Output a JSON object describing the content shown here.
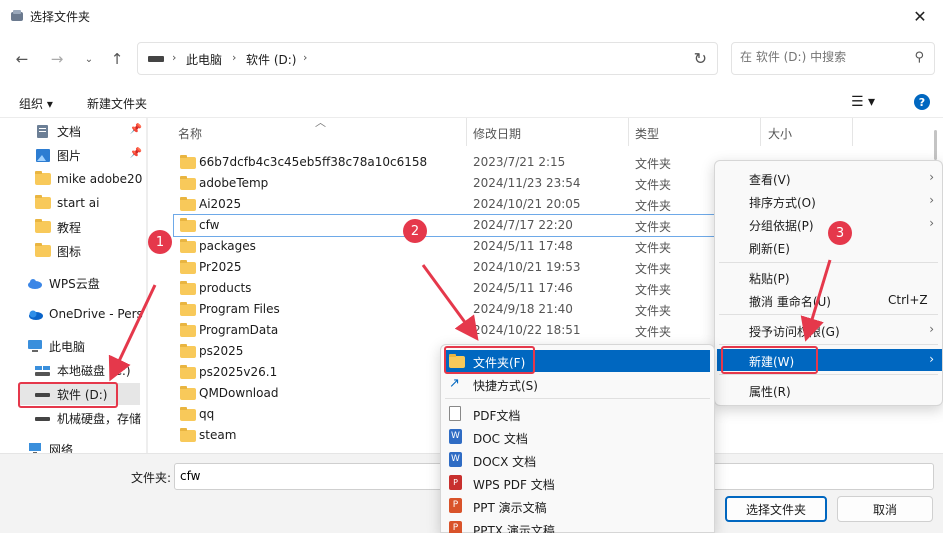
{
  "window": {
    "title": "选择文件夹",
    "close_glyph": "✕"
  },
  "address": {
    "segments": [
      "此电脑",
      "软件 (D:)"
    ]
  },
  "search": {
    "placeholder": "在 软件 (D:) 中搜索"
  },
  "toolbar": {
    "organize": "组织 ▾",
    "new_folder": "新建文件夹"
  },
  "sidebar": {
    "items": [
      {
        "label": "文档",
        "icon": "documents-icon",
        "pinned": true
      },
      {
        "label": "图片",
        "icon": "pictures-icon",
        "pinned": true
      },
      {
        "label": "mike adobe20",
        "icon": "folder-icon"
      },
      {
        "label": "start ai",
        "icon": "folder-icon"
      },
      {
        "label": "教程",
        "icon": "folder-icon"
      },
      {
        "label": "图标",
        "icon": "folder-icon"
      },
      {
        "label": "WPS云盘",
        "icon": "cloud-icon"
      },
      {
        "label": "OneDrive - Pers",
        "icon": "onedrive-icon"
      },
      {
        "label": "此电脑",
        "icon": "computer-icon"
      },
      {
        "label": "本地磁盘 (C:)",
        "icon": "drive-icon"
      },
      {
        "label": "软件 (D:)",
        "icon": "drive-icon",
        "selected": true
      },
      {
        "label": "机械硬盘，存储",
        "icon": "drive-icon"
      },
      {
        "label": "网络",
        "icon": "network-icon"
      }
    ]
  },
  "columns": {
    "name": "名称",
    "date": "修改日期",
    "type": "类型",
    "size": "大小"
  },
  "files": [
    {
      "name": "66b7dcfb4c3c45eb5ff38c78a10c6158",
      "date": "2023/7/21 2:15",
      "type": "文件夹"
    },
    {
      "name": "adobeTemp",
      "date": "2024/11/23 23:54",
      "type": "文件夹"
    },
    {
      "name": "Ai2025",
      "date": "2024/10/21 20:05",
      "type": "文件夹"
    },
    {
      "name": "cfw",
      "date": "2024/7/17 22:20",
      "type": "文件夹"
    },
    {
      "name": "packages",
      "date": "2024/5/11 17:48",
      "type": "文件夹"
    },
    {
      "name": "Pr2025",
      "date": "2024/10/21 19:53",
      "type": "文件夹"
    },
    {
      "name": "products",
      "date": "2024/5/11 17:46",
      "type": "文件夹"
    },
    {
      "name": "Program Files",
      "date": "2024/9/18 21:40",
      "type": "文件夹"
    },
    {
      "name": "ProgramData",
      "date": "2024/10/22 18:51",
      "type": "文件夹"
    },
    {
      "name": "ps2025",
      "date": "",
      "type": ""
    },
    {
      "name": "ps2025v26.1",
      "date": "",
      "type": ""
    },
    {
      "name": "QMDownload",
      "date": "",
      "type": ""
    },
    {
      "name": "qq",
      "date": "",
      "type": ""
    },
    {
      "name": "steam",
      "date": "",
      "type": ""
    }
  ],
  "context_menu": {
    "items": [
      {
        "label": "查看(V)",
        "submenu": true
      },
      {
        "label": "排序方式(O)",
        "submenu": true
      },
      {
        "label": "分组依据(P)",
        "submenu": true
      },
      {
        "label": "刷新(E)"
      },
      {
        "label": "粘贴(P)"
      },
      {
        "label": "撤消 重命名(U)",
        "shortcut": "Ctrl+Z"
      },
      {
        "label": "授予访问权限(G)",
        "submenu": true
      },
      {
        "label": "新建(W)",
        "submenu": true,
        "highlighted": true
      },
      {
        "label": "属性(R)"
      }
    ]
  },
  "new_submenu": {
    "items": [
      {
        "label": "文件夹(F)",
        "icon": "folder-icon",
        "highlighted": true
      },
      {
        "label": "快捷方式(S)",
        "icon": "shortcut-icon"
      },
      {
        "label": "PDF文档",
        "icon": "pdf-doc-icon"
      },
      {
        "label": "DOC 文档",
        "icon": "word-icon"
      },
      {
        "label": "DOCX 文档",
        "icon": "word-icon"
      },
      {
        "label": "WPS PDF 文档",
        "icon": "wps-pdf-icon"
      },
      {
        "label": "PPT 演示文稿",
        "icon": "ppt-icon"
      },
      {
        "label": "PPTX 演示文稿",
        "icon": "ppt-icon"
      }
    ]
  },
  "footer": {
    "folder_label": "文件夹:",
    "folder_value": "cfw",
    "select_button": "选择文件夹",
    "cancel_button": "取消"
  },
  "annotations": {
    "badge1": "1",
    "badge2": "2",
    "badge3": "3",
    "accent": "#e5384b"
  },
  "colors": {
    "accent": "#0067c0",
    "folder": "#f8c95a",
    "annotation": "#e5384b"
  }
}
